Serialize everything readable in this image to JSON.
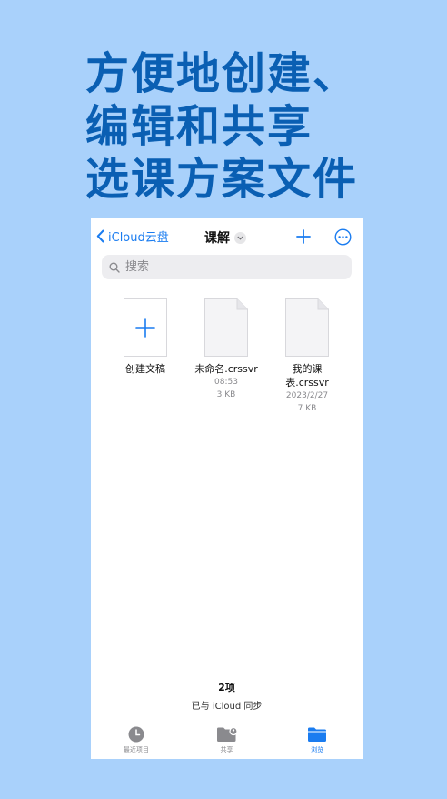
{
  "headline": {
    "line1": "方便地创建、",
    "line2": "编辑和共享",
    "line3": "选课方案文件"
  },
  "navbar": {
    "back_label": "iCloud云盘",
    "title": "课解"
  },
  "search": {
    "placeholder": "搜索"
  },
  "items": [
    {
      "name": "创建文稿",
      "time": "",
      "size": ""
    },
    {
      "name": "未命名.crssvr",
      "time": "08:53",
      "size": "3 KB"
    },
    {
      "name_line1": "我的课",
      "name_line2": "表.crssvr",
      "time": "2023/2/27",
      "size": "7 KB"
    }
  ],
  "footer": {
    "count": "2项",
    "sync": "已与 iCloud 同步"
  },
  "tabs": [
    {
      "label": "最近项目",
      "icon": "clock-icon"
    },
    {
      "label": "共享",
      "icon": "shared-folder-icon"
    },
    {
      "label": "浏览",
      "icon": "folder-icon"
    }
  ],
  "colors": {
    "background": "#a9d1fb",
    "headline": "#0a5fb3",
    "accent": "#1a7cf0"
  }
}
